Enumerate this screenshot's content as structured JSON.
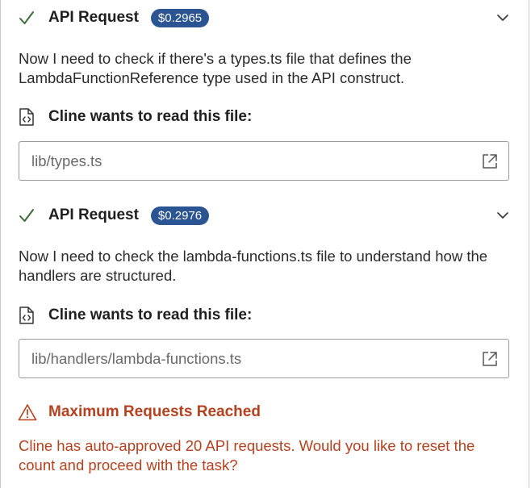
{
  "requests": [
    {
      "title": "API Request",
      "cost": "$0.2965",
      "description": "Now I need to check if there's a types.ts file that defines the LambdaFunctionReference type used in the API construct.",
      "read_label": "Cline wants to read this file:",
      "file_path": "lib/types.ts"
    },
    {
      "title": "API Request",
      "cost": "$0.2976",
      "description": "Now I need to check the lambda-functions.ts file to understand how the handlers are structured.",
      "read_label": "Cline wants to read this file:",
      "file_path": "lib/handlers/lambda-functions.ts"
    }
  ],
  "warning": {
    "title": "Maximum Requests Reached",
    "message": "Cline has auto-approved 20 API requests. Would you like to reset the count and proceed with the task?"
  },
  "icons": {
    "status": "check-icon",
    "expand": "chevron-down-icon",
    "file": "file-code-icon",
    "open": "external-link-icon",
    "warning": "warning-icon"
  },
  "colors": {
    "badge": "#2a5592",
    "warning": "#b5411f",
    "check": "#3b6e3a"
  }
}
